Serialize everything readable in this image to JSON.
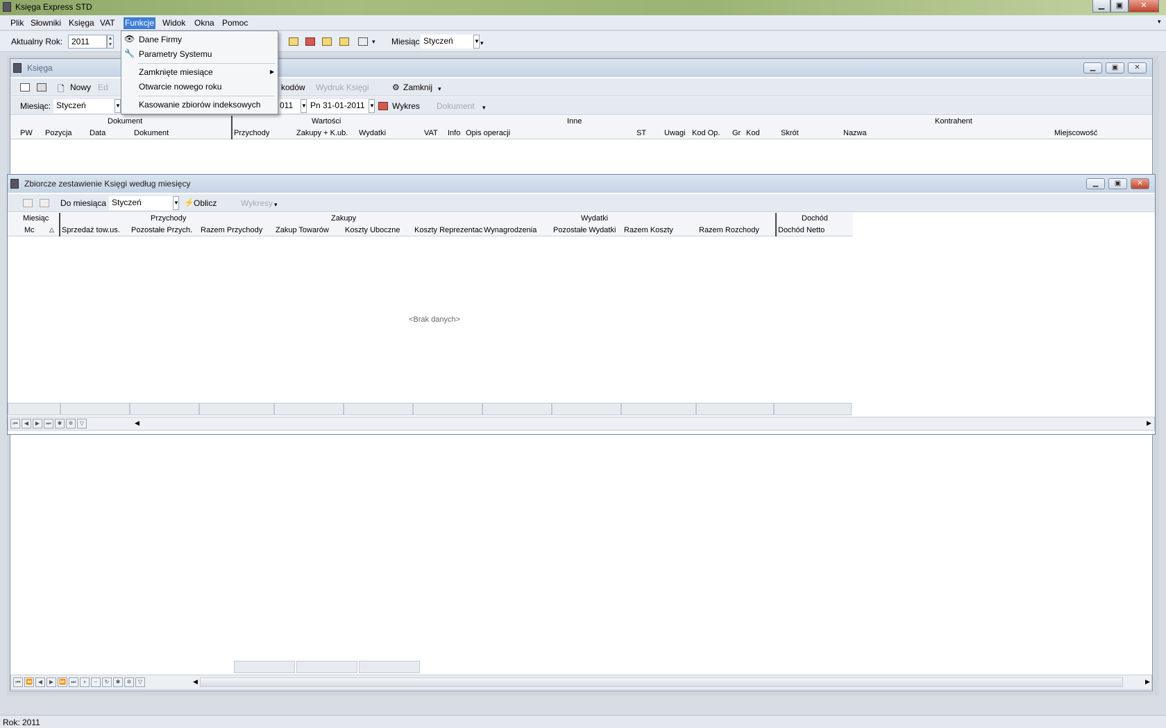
{
  "app": {
    "title": "Księga Express STD"
  },
  "menu": [
    "Plik",
    "Słowniki",
    "Księga",
    "VAT",
    "Funkcje",
    "Widok",
    "Okna",
    "Pomoc"
  ],
  "toolbar": {
    "year_label": "Aktualny Rok:",
    "year_value": "2011",
    "month_label": "Miesiąc",
    "month_value": "Styczeń"
  },
  "dropdown": {
    "items": [
      "Dane Firmy",
      "Parametry Systemu",
      "Zamknięte miesiące",
      "Otwarcie nowego roku",
      "Kasowanie zbiorów indeksowych"
    ]
  },
  "ksiega": {
    "title": "Księga",
    "toolbar": {
      "new_label": "Nowy",
      "edit_label": "Ed",
      "codes_label": "g kodów",
      "print_label": "Wydruk Księgi",
      "close_label": "Zamknij"
    },
    "filter": {
      "month_label": "Miesiąc:",
      "month_value": "Styczeń",
      "date_from": "011",
      "date_to": "Pn 31-01-2011",
      "chart_label": "Wykres",
      "document_label": "Dokument"
    },
    "groups": [
      "Dokument",
      "Wartości",
      "Inne",
      "Kontrahent"
    ],
    "columns": [
      "PW",
      "Pozycja",
      "Data",
      "Dokument",
      "Przychody",
      "Zakupy + K.ub.",
      "Wydatki",
      "VAT",
      "Info",
      "Opis operacji",
      "ST",
      "Uwagi",
      "Kod Op.",
      "Gr",
      "Kod",
      "Skrót",
      "Nazwa",
      "Miejscowość"
    ]
  },
  "zestawienie": {
    "title": "Zbiorcze zestawienie Księgi według miesięcy",
    "toolbar": {
      "to_month_label": "Do miesiąca",
      "to_month_value": "Styczeń",
      "calc_label": "Oblicz",
      "charts_label": "Wykresy"
    },
    "groups": [
      "Miesiąc",
      "Przychody",
      "Zakupy",
      "Wydatki",
      "Dochód"
    ],
    "columns": [
      "Mc",
      "Sprzedaż tow.us.",
      "Pozostałe Przych.",
      "Razem Przychody",
      "Zakup Towarów",
      "Koszty Uboczne",
      "Koszty Reprezentac",
      "Wynagrodzenia",
      "Pozostałe Wydatki",
      "Razem Koszty",
      "Razem Rozchody",
      "Dochód Netto"
    ],
    "empty": "<Brak danych>"
  },
  "status": {
    "text": "Rok: 2011"
  }
}
